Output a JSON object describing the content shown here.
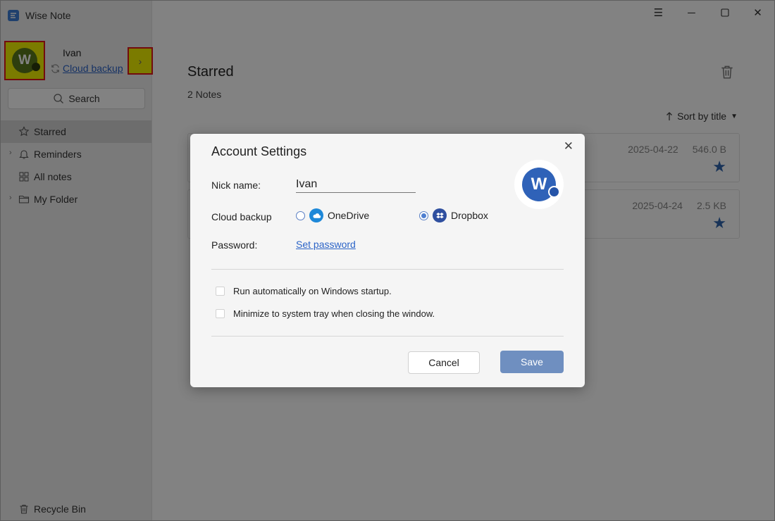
{
  "app": {
    "title": "Wise Note",
    "accent": "#3d7fd6"
  },
  "sidebar": {
    "user_name": "Ivan",
    "avatar_letter": "W",
    "cloud_link": "Cloud backup",
    "search_label": "Search",
    "items": [
      {
        "label": "Starred",
        "icon": "star-icon",
        "active": true
      },
      {
        "label": "Reminders",
        "icon": "bell-icon",
        "has_chevron": true
      },
      {
        "label": "All notes",
        "icon": "grid-icon"
      },
      {
        "label": "My Folder",
        "icon": "folder-icon",
        "has_chevron": true
      }
    ],
    "recycle_label": "Recycle Bin"
  },
  "main": {
    "title": "Starred",
    "count": "2 Notes",
    "sort_label": "Sort by title",
    "notes": [
      {
        "date": "2025-04-22",
        "size": "546.0 B",
        "starred": true
      },
      {
        "date": "2025-04-24",
        "size": "2.5 KB",
        "starred": true
      }
    ]
  },
  "dialog": {
    "title": "Account Settings",
    "avatar_letter": "W",
    "nick_label": "Nick name:",
    "nick_value": "Ivan",
    "cloud_label": "Cloud backup",
    "onedrive_label": "OneDrive",
    "dropbox_label": "Dropbox",
    "selected_cloud": "Dropbox",
    "password_label": "Password:",
    "set_password": "Set password",
    "startup_label": "Run automatically on Windows startup.",
    "tray_label": "Minimize to system tray when closing the window.",
    "cancel_label": "Cancel",
    "save_label": "Save"
  }
}
